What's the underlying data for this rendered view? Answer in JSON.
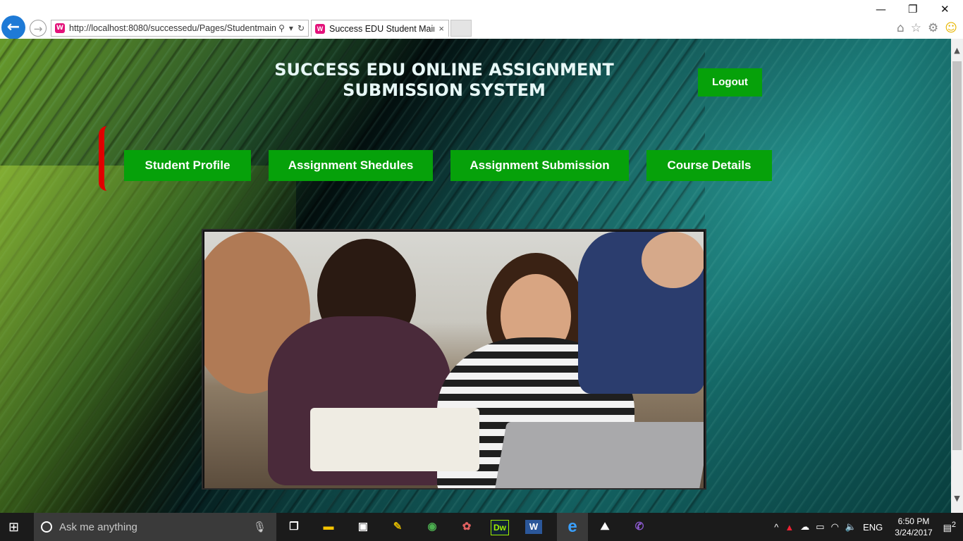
{
  "browser": {
    "url_host": "http://localhost",
    "url_rest": ":8080/successedu/Pages/Studentmain",
    "tab_title": "Success EDU Student Main ...",
    "tab_close": "×",
    "favicon_letter": "W"
  },
  "window_controls": {
    "minimize": "—",
    "restore": "❐",
    "close": "✕"
  },
  "page": {
    "title": "SUCCESS EDU ONLINE ASSIGNMENT SUBMISSION SYSTEM",
    "logout_label": "Logout",
    "nav": [
      {
        "label": "Student Profile"
      },
      {
        "label": "Assignment Shedules"
      },
      {
        "label": "Assignment Submission"
      },
      {
        "label": "Course Details"
      }
    ],
    "accent_color": "#06a10a",
    "bracket_color": "#e00000"
  },
  "taskbar": {
    "search_placeholder": "Ask me anything",
    "language": "ENG",
    "time": "6:50 PM",
    "date": "3/24/2017",
    "notification_count": "2",
    "apps": [
      {
        "icon": "task-view-icon"
      },
      {
        "icon": "file-explorer-icon"
      },
      {
        "icon": "store-icon"
      },
      {
        "icon": "tools-icon"
      },
      {
        "icon": "chrome-icon"
      },
      {
        "icon": "paint-icon"
      },
      {
        "icon": "dreamweaver-icon",
        "label": "Dw"
      },
      {
        "icon": "word-icon",
        "label": "W"
      },
      {
        "icon": "internet-explorer-icon",
        "label": "e"
      },
      {
        "icon": "photos-icon"
      },
      {
        "icon": "viber-icon"
      }
    ]
  }
}
